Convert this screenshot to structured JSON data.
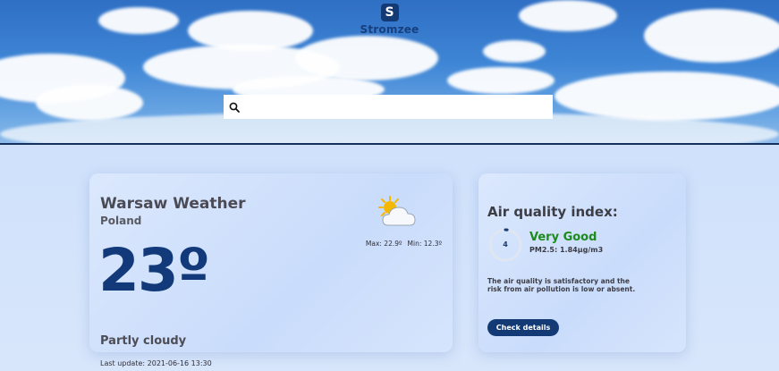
{
  "header": {
    "logo_letter": "S",
    "brand_name": "Stromzee",
    "search": {
      "value": "",
      "placeholder": ""
    }
  },
  "weather": {
    "city_title": "Warsaw Weather",
    "country": "Poland",
    "temperature": "23º",
    "condition": "Partly cloudy",
    "last_update": "Last update: 2021-06-16 13:30",
    "max": "Max: 22.9º",
    "min": "Min: 12.3º",
    "icon": "partly-cloudy-icon"
  },
  "air_quality": {
    "title": "Air quality index:",
    "index": "4",
    "status": "Very Good",
    "pm": "PM2.5: 1.84µg/m3",
    "description": "The air quality is satisfactory and the risk from air pollution is low or absent.",
    "button_label": "Check details",
    "gauge_fraction": 0.02
  },
  "colors": {
    "brand": "#143a75",
    "good_status": "#1c8a1c",
    "header_border": "#13315f"
  }
}
